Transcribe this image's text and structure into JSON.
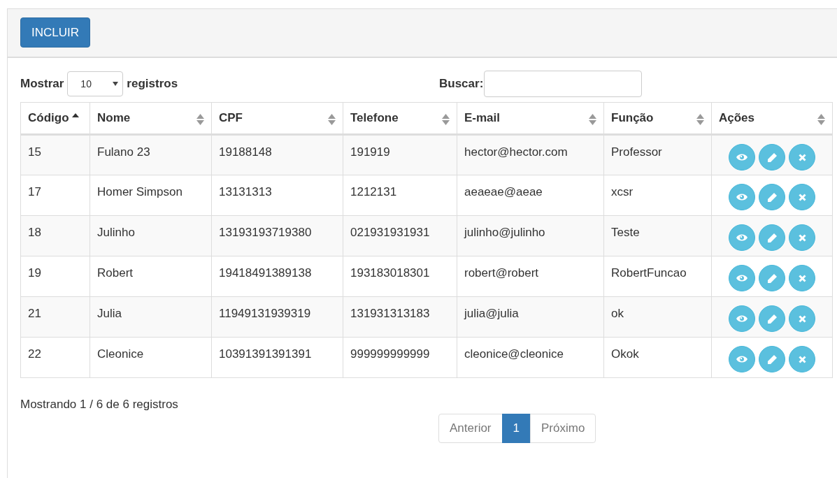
{
  "toolbar": {
    "add_button": "INCLUIR"
  },
  "length": {
    "label_before": "Mostrar",
    "value": "10",
    "label_after": "registros"
  },
  "search": {
    "label": "Buscar:"
  },
  "table": {
    "columns": [
      {
        "label": "Código",
        "sorted": true
      },
      {
        "label": "Nome",
        "sorted": false
      },
      {
        "label": "CPF",
        "sorted": false
      },
      {
        "label": "Telefone",
        "sorted": false
      },
      {
        "label": "E-mail",
        "sorted": false
      },
      {
        "label": "Função",
        "sorted": false
      },
      {
        "label": "Ações",
        "sorted": false
      }
    ],
    "rows": [
      [
        "15",
        "Fulano 23",
        "19188148",
        "191919",
        "hector@hector.com",
        "Professor"
      ],
      [
        "17",
        "Homer Simpson",
        "13131313",
        "1212131",
        "aeaeae@aeae",
        "xcsr"
      ],
      [
        "18",
        "Julinho",
        "13193193719380",
        "021931931931",
        "julinho@julinho",
        "Teste"
      ],
      [
        "19",
        "Robert",
        "19418491389138",
        "193183018301",
        "robert@robert",
        "RobertFuncao"
      ],
      [
        "21",
        "Julia",
        "11949131939319",
        "131931313183",
        "julia@julia",
        "ok"
      ],
      [
        "22",
        "Cleonice",
        "10391391391391",
        "999999999999",
        "cleonice@cleonice",
        "Okok"
      ]
    ]
  },
  "info": "Mostrando 1 / 6 de 6 registros",
  "pagination": [
    {
      "label": "Anterior",
      "kind": "prev",
      "selected": false
    },
    {
      "label": "1",
      "kind": "page",
      "selected": true
    },
    {
      "label": "Próximo",
      "kind": "next",
      "selected": false
    }
  ]
}
